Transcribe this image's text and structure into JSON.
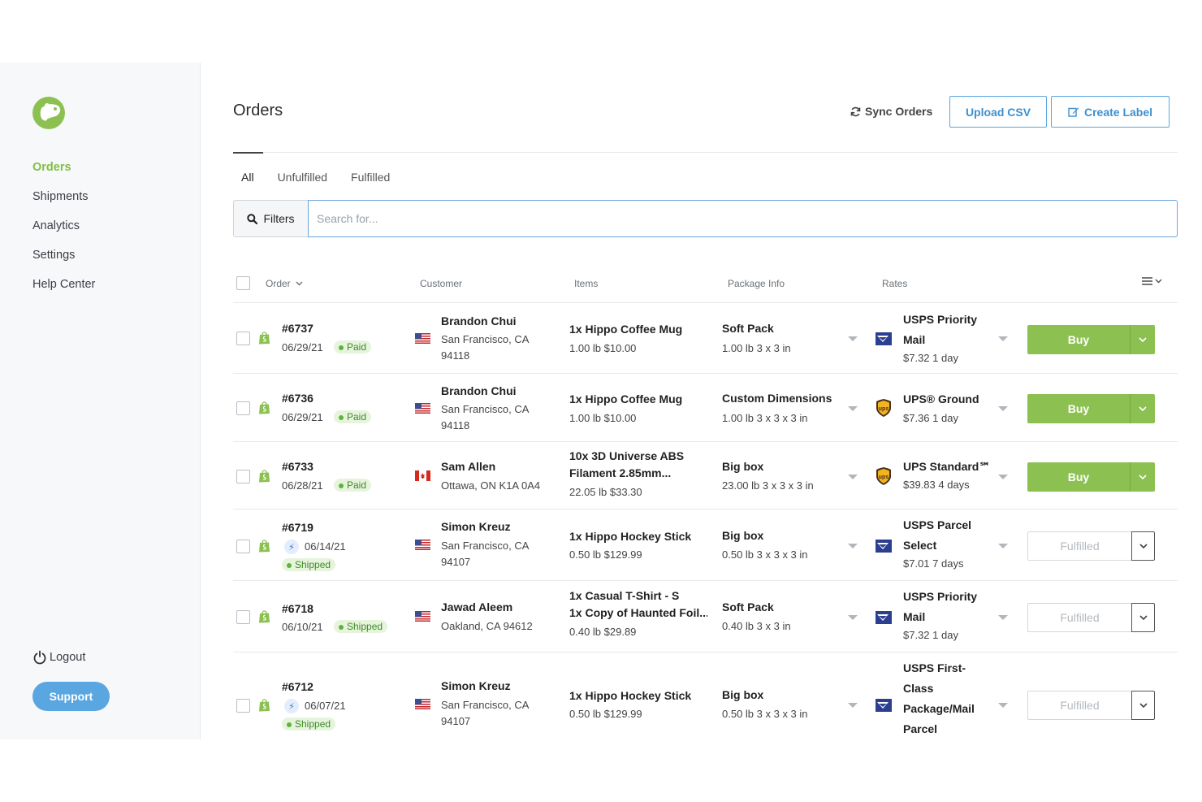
{
  "sidebar": {
    "nav": [
      "Orders",
      "Shipments",
      "Analytics",
      "Settings",
      "Help Center"
    ],
    "logout": "Logout",
    "support": "Support"
  },
  "header": {
    "title": "Orders",
    "sync": "Sync Orders",
    "upload": "Upload CSV",
    "create": "Create Label"
  },
  "tabs": [
    "All",
    "Unfulfilled",
    "Fulfilled"
  ],
  "search": {
    "filters": "Filters",
    "placeholder": "Search for..."
  },
  "columns": {
    "order": "Order",
    "customer": "Customer",
    "items": "Items",
    "package": "Package Info",
    "rates": "Rates"
  },
  "orders": [
    {
      "num": "#6737",
      "date": "06/29/21",
      "status": "Paid",
      "flag": "US",
      "name": "Brandon Chui",
      "addr1": "San Francisco, CA",
      "addr2": "94118",
      "item1": "1x Hippo Coffee Mug",
      "item2": "",
      "item_meta": "1.00 lb   $10.00",
      "pkg": "Soft Pack",
      "pkg_meta": "1.00 lb   3 x 3 in",
      "carrier": "usps",
      "rate1": "USPS Priority",
      "rate2": "Mail",
      "rate3": "",
      "rate4": "",
      "rate_meta": "$7.32   1 day",
      "action": "Buy"
    },
    {
      "num": "#6736",
      "date": "06/29/21",
      "status": "Paid",
      "flag": "US",
      "name": "Brandon Chui",
      "addr1": "San Francisco, CA",
      "addr2": "94118",
      "item1": "1x Hippo Coffee Mug",
      "item2": "",
      "item_meta": "1.00 lb   $10.00",
      "pkg": "Custom Dimensions",
      "pkg_meta": "1.00 lb   3 x 3 x 3 in",
      "carrier": "ups",
      "rate1": "UPS® Ground",
      "rate2": "",
      "rate3": "",
      "rate4": "",
      "rate_meta": "$7.36   1 day",
      "action": "Buy"
    },
    {
      "num": "#6733",
      "date": "06/28/21",
      "status": "Paid",
      "flag": "CA",
      "name": "Sam Allen",
      "addr1": "Ottawa, ON K1A 0A4",
      "addr2": "",
      "item1": "10x 3D Universe ABS",
      "item2": "Filament 2.85mm...",
      "item_meta": "22.05 lb   $33.30",
      "pkg": "Big box",
      "pkg_meta": "23.00 lb   3 x 3 x 3 in",
      "carrier": "ups",
      "rate1": "UPS Standard℠",
      "rate2": "",
      "rate3": "",
      "rate4": "",
      "rate_meta": "$39.83   4 days",
      "action": "Buy"
    },
    {
      "num": "#6719",
      "date": "06/14/21",
      "status": "Shipped",
      "flag": "US",
      "name": "Simon Kreuz",
      "addr1": "San Francisco, CA",
      "addr2": "94107",
      "item1": "1x Hippo Hockey Stick",
      "item2": "",
      "item_meta": "0.50 lb   $129.99",
      "pkg": "Big box",
      "pkg_meta": "0.50 lb   3 x 3 x 3 in",
      "carrier": "usps",
      "rate1": "USPS Parcel",
      "rate2": "Select",
      "rate3": "",
      "rate4": "",
      "rate_meta": "$7.01   7 days",
      "action": "Fulfilled"
    },
    {
      "num": "#6718",
      "date": "06/10/21",
      "status": "Shipped",
      "flag": "US",
      "name": "Jawad Aleem",
      "addr1": "Oakland, CA 94612",
      "addr2": "",
      "item1": "1x Casual T-Shirt - S",
      "item2": "1x Copy of Haunted Foil...",
      "item_meta": "0.40 lb   $29.89",
      "pkg": "Soft Pack",
      "pkg_meta": "0.40 lb   3 x 3 in",
      "carrier": "usps",
      "rate1": "USPS Priority",
      "rate2": "Mail",
      "rate3": "",
      "rate4": "",
      "rate_meta": "$7.32   1 day",
      "action": "Fulfilled"
    },
    {
      "num": "#6712",
      "date": "06/07/21",
      "status": "Shipped",
      "flag": "US",
      "name": "Simon Kreuz",
      "addr1": "San Francisco, CA",
      "addr2": "94107",
      "item1": "1x Hippo Hockey Stick",
      "item2": "",
      "item_meta": "0.50 lb   $129.99",
      "pkg": "Big box",
      "pkg_meta": "0.50 lb   3 x 3 x 3 in",
      "carrier": "usps",
      "rate1": "USPS First-",
      "rate2": "Class",
      "rate3": "Package/Mail",
      "rate4": "Parcel",
      "rate_meta": "",
      "action": "Fulfilled"
    }
  ]
}
